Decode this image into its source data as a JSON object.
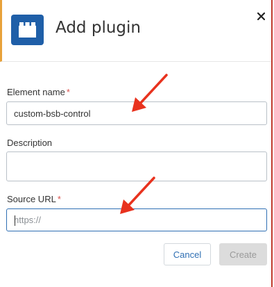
{
  "dialog": {
    "title": "Add plugin",
    "icon": "plugin-block-icon",
    "close_icon": "close-icon",
    "accent_color": "#e8a23a",
    "icon_color": "#1f5fa8"
  },
  "form": {
    "element_name": {
      "label": "Element name",
      "required_marker": "*",
      "value": "custom-bsb-control",
      "placeholder": ""
    },
    "description": {
      "label": "Description",
      "value": "",
      "placeholder": ""
    },
    "source_url": {
      "label": "Source URL",
      "required_marker": "*",
      "value": "",
      "placeholder": "https://"
    }
  },
  "actions": {
    "cancel_label": "Cancel",
    "create_label": "Create"
  },
  "annotations": {
    "arrow_color": "#e8321e"
  }
}
